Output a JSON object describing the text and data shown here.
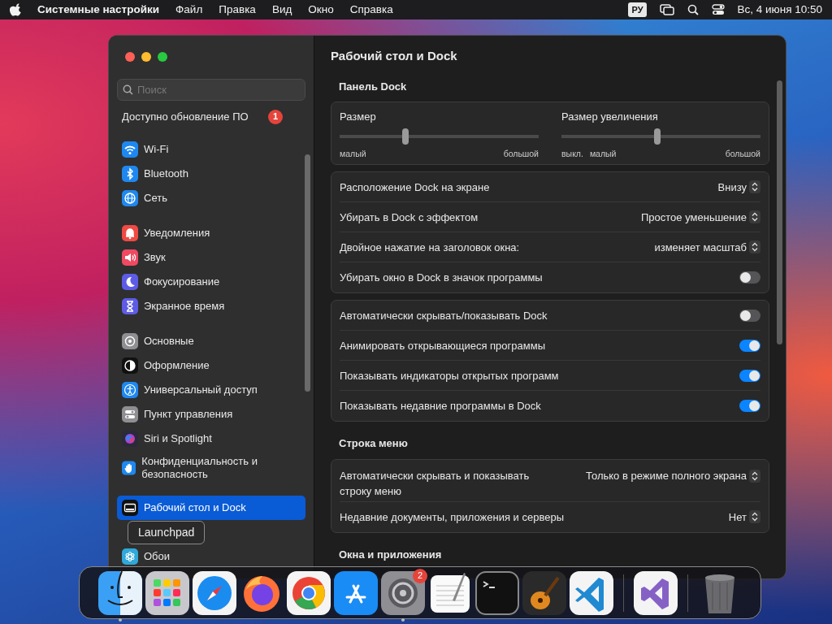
{
  "menubar": {
    "app": "Системные настройки",
    "menus": [
      "Файл",
      "Правка",
      "Вид",
      "Окно",
      "Справка"
    ],
    "input_source": "РУ",
    "clock": "Вс, 4 июня  10:50"
  },
  "sidebar": {
    "search": {
      "placeholder": "Поиск"
    },
    "update": {
      "label": "Доступно обновление ПО",
      "badge": "1"
    },
    "groups": [
      [
        {
          "label": "Wi-Fi",
          "selected": false
        },
        {
          "label": "Bluetooth",
          "selected": false
        },
        {
          "label": "Сеть",
          "selected": false
        }
      ],
      [
        {
          "label": "Уведомления",
          "selected": false
        },
        {
          "label": "Звук",
          "selected": false
        },
        {
          "label": "Фокусирование",
          "selected": false
        },
        {
          "label": "Экранное время",
          "selected": false
        }
      ],
      [
        {
          "label": "Основные",
          "selected": false
        },
        {
          "label": "Оформление",
          "selected": false
        },
        {
          "label": "Универсальный доступ",
          "selected": false
        },
        {
          "label": "Пункт управления",
          "selected": false
        },
        {
          "label": "Siri и Spotlight",
          "selected": false
        },
        {
          "label": "Конфиденциальность и безопасность",
          "selected": false
        }
      ],
      [
        {
          "label": "Рабочий стол и Dock",
          "selected": true
        },
        {
          "label": "Обои",
          "selected": false
        }
      ]
    ]
  },
  "tooltip": "Launchpad",
  "content": {
    "title": "Рабочий стол и Dock",
    "sections": [
      {
        "heading": "Панель Dock",
        "sliders": [
          {
            "label": "Размер",
            "level": 0.33,
            "marks": [
              "малый",
              "большой"
            ]
          },
          {
            "label": "Размер увеличения",
            "level": 0.48,
            "marks": [
              "выкл.",
              "малый",
              "большой"
            ]
          }
        ],
        "cards": [
          [
            {
              "kind": "popup",
              "label": "Расположение Dock на экране",
              "value": "Внизу"
            },
            {
              "kind": "popup",
              "label": "Убирать в Dock с эффектом",
              "value": "Простое уменьшение"
            },
            {
              "kind": "popup",
              "label": "Двойное нажатие на заголовок окна:",
              "value": "изменяет масштаб"
            },
            {
              "kind": "toggle",
              "label": "Убирать окно в Dock в значок программы",
              "on": false
            }
          ],
          [
            {
              "kind": "toggle",
              "label": "Автоматически скрывать/показывать Dock",
              "on": false
            },
            {
              "kind": "toggle",
              "label": "Анимировать открывающиеся программы",
              "on": true
            },
            {
              "kind": "toggle",
              "label": "Показывать индикаторы открытых программ",
              "on": true
            },
            {
              "kind": "toggle",
              "label": "Показывать недавние программы в Dock",
              "on": true
            }
          ]
        ]
      },
      {
        "heading": "Строка меню",
        "cards": [
          [
            {
              "kind": "popup",
              "label": "Автоматически скрывать и показывать строку меню",
              "value": "Только в режиме полного экрана"
            },
            {
              "kind": "popup",
              "label": "Недавние документы, приложения и серверы",
              "value": "Нет"
            }
          ]
        ]
      },
      {
        "heading": "Окна и приложения"
      }
    ]
  },
  "dock": [
    {
      "kind": "app",
      "running": true
    },
    {
      "kind": "app"
    },
    {
      "kind": "app"
    },
    {
      "kind": "app"
    },
    {
      "kind": "app"
    },
    {
      "kind": "app"
    },
    {
      "kind": "app",
      "running": true,
      "badge": "2"
    },
    {
      "kind": "app"
    },
    {
      "kind": "app"
    },
    {
      "kind": "app"
    },
    {
      "kind": "app"
    },
    {
      "kind": "separator"
    },
    {
      "kind": "app"
    },
    {
      "kind": "separator"
    },
    {
      "kind": "app"
    }
  ]
}
